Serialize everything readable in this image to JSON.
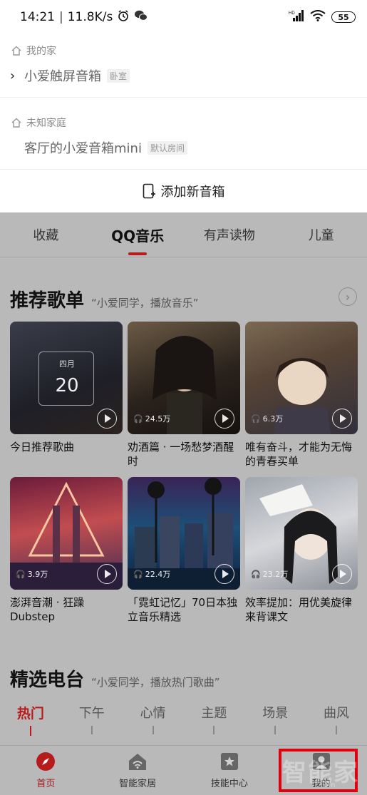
{
  "status_bar": {
    "time": "14:21",
    "net_speed": "11.8K/s",
    "battery": "55",
    "signal_label": "HD"
  },
  "homes": [
    {
      "name": "我的家",
      "device": "小爱触屏音箱",
      "room": "卧室"
    },
    {
      "name": "未知家庭",
      "device": "客厅的小爱音箱mini",
      "room": "默认房间"
    }
  ],
  "add_speaker_label": "添加新音箱",
  "tabs": [
    "收藏",
    "QQ音乐",
    "有声读物",
    "儿童"
  ],
  "active_tab": "QQ音乐",
  "recommended": {
    "title": "推荐歌单",
    "subtitle": "“小爱同学，播放音乐”",
    "items": [
      {
        "title": "今日推荐歌曲",
        "plays": "",
        "cal_month": "四月",
        "cal_day": "20"
      },
      {
        "title": "劝酒篇 · 一场愁梦酒醒时",
        "plays": "24.5万"
      },
      {
        "title": "唯有奋斗，才能为无悔的青春买单",
        "plays": "6.3万"
      },
      {
        "title": "澎湃音潮 · 狂躁Dubstep",
        "plays": "3.9万"
      },
      {
        "title": "「霓虹记忆」70日本独立音乐精选",
        "plays": "22.4万"
      },
      {
        "title": "效率提加：用优美旋律来背课文",
        "plays": "23.2万"
      }
    ]
  },
  "radio": {
    "title": "精选电台",
    "subtitle": "“小爱同学，播放热门歌曲”",
    "tabs": [
      "热门",
      "下午",
      "心情",
      "主题",
      "场景",
      "曲风"
    ],
    "active": "热门"
  },
  "bottom_nav": [
    {
      "label": "首页",
      "icon": "compass-icon",
      "active": true
    },
    {
      "label": "智能家居",
      "icon": "smart-home-icon",
      "active": false
    },
    {
      "label": "技能中心",
      "icon": "star-box-icon",
      "active": false
    },
    {
      "label": "我的",
      "icon": "profile-icon",
      "active": false
    }
  ],
  "watermark": {
    "text": "智能家",
    "url": ".com"
  },
  "colors": {
    "accent": "#b71c1c",
    "overlay": "#b9b9b9",
    "highlight": "#e0000e"
  }
}
